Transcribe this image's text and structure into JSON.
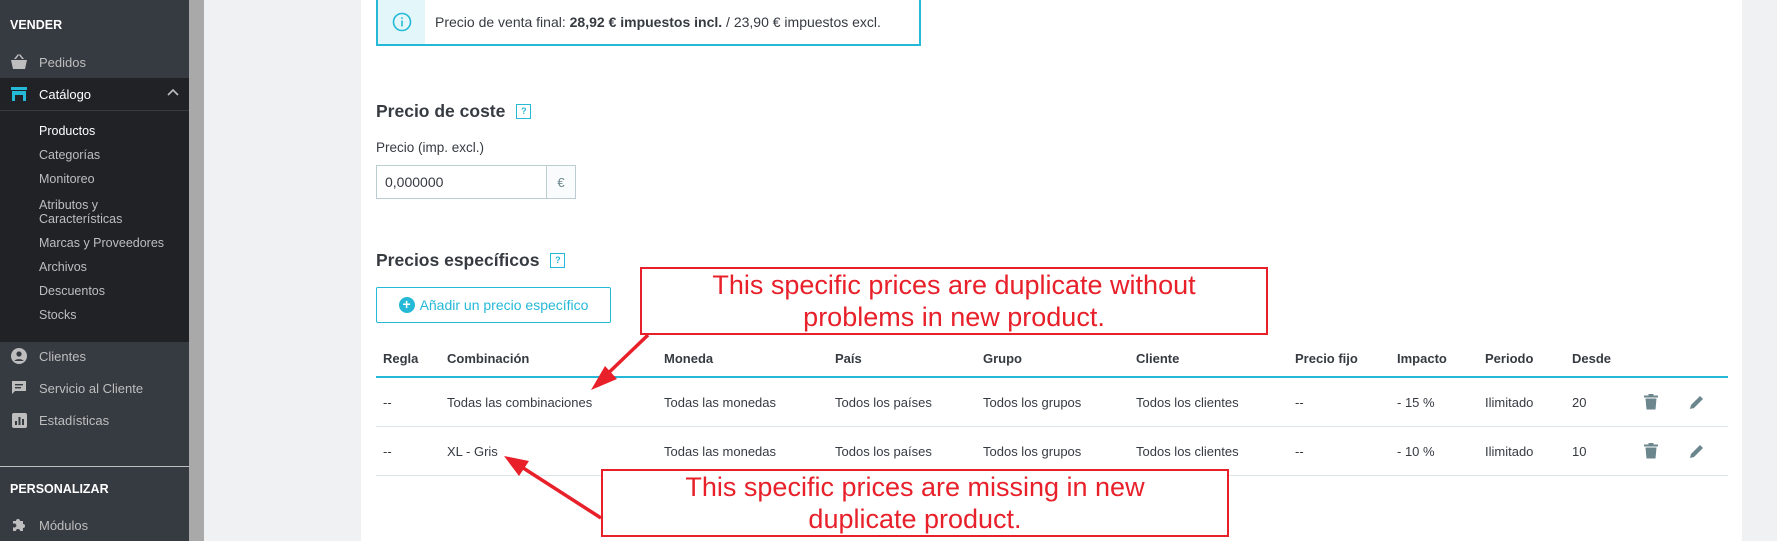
{
  "sidebar": {
    "section_sell": "VENDER",
    "orders": "Pedidos",
    "catalog": "Catálogo",
    "sub_items": [
      "Productos",
      "Categorías",
      "Monitoreo",
      "Atributos y",
      "Características",
      "Marcas y Proveedores",
      "Archivos",
      "Descuentos",
      "Stocks"
    ],
    "customers": "Clientes",
    "customer_service": "Servicio al Cliente",
    "stats": "Estadísticas",
    "section_customize": "PERSONALIZAR",
    "modules": "Módulos"
  },
  "info": {
    "prefix": "Precio de venta final:",
    "bold": "28,92 € impuestos incl.",
    "suffix": "/ 23,90 € impuestos excl."
  },
  "cost": {
    "title": "Precio de coste",
    "help": "?",
    "label": "Precio (imp. excl.)",
    "value": "0,000000",
    "currency": "€"
  },
  "specific": {
    "title": "Precios específicos",
    "help": "?",
    "add_button": "Añadir un precio específico",
    "headers": [
      "Regla",
      "Combinación",
      "Moneda",
      "País",
      "Grupo",
      "Cliente",
      "Precio fijo",
      "Impacto",
      "Periodo",
      "Desde"
    ],
    "rows": [
      [
        "--",
        "Todas las combinaciones",
        "Todas las monedas",
        "Todos los países",
        "Todos los grupos",
        "Todos los clientes",
        "--",
        "- 15 %",
        "Ilimitado",
        "20"
      ],
      [
        "--",
        "XL - Gris",
        "Todas las monedas",
        "Todos los países",
        "Todos los grupos",
        "Todos los clientes",
        "--",
        "- 10 %",
        "Ilimitado",
        "10"
      ]
    ]
  },
  "annotations": {
    "top_line1": "This specific prices are duplicate without",
    "top_line2": "problems in new product.",
    "bottom_line1": "This specific prices are missing in new",
    "bottom_line2": "duplicate product."
  },
  "colors": {
    "accent": "#25b9d7",
    "annotation": "#e8202a",
    "sidebar": "#363a41"
  }
}
